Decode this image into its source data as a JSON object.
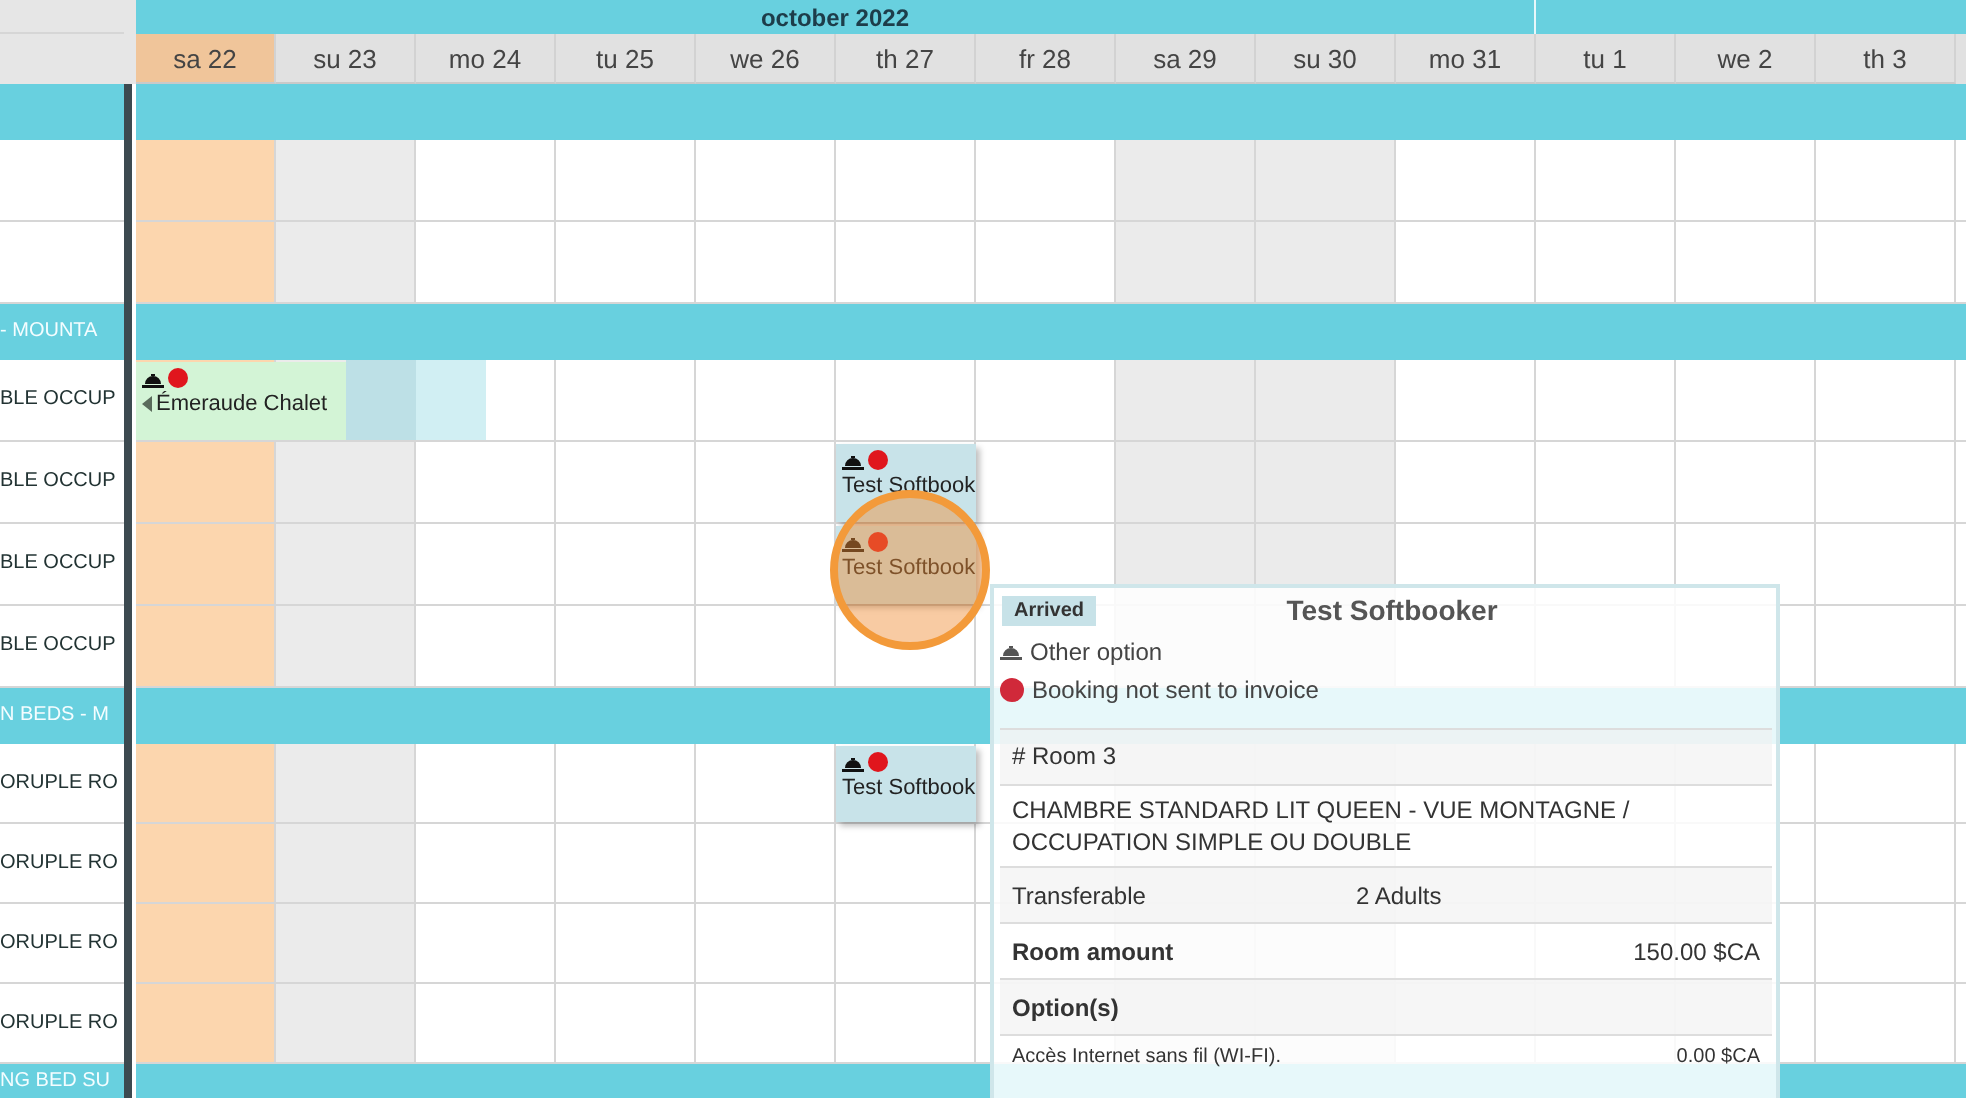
{
  "calendar": {
    "month": "october 2022",
    "days": [
      {
        "label": "sa 22",
        "kind": "today"
      },
      {
        "label": "su 23",
        "kind": "weekend"
      },
      {
        "label": "mo 24",
        "kind": "weekday"
      },
      {
        "label": "tu 25",
        "kind": "weekday"
      },
      {
        "label": "we 26",
        "kind": "weekday"
      },
      {
        "label": "th 27",
        "kind": "weekday"
      },
      {
        "label": "fr 28",
        "kind": "weekday"
      },
      {
        "label": "sa 29",
        "kind": "weekend"
      },
      {
        "label": "su 30",
        "kind": "weekend"
      },
      {
        "label": "mo 31",
        "kind": "weekday"
      },
      {
        "label": "tu 1",
        "kind": "weekday"
      },
      {
        "label": "we 2",
        "kind": "weekday"
      },
      {
        "label": "th 3",
        "kind": "weekday"
      }
    ],
    "rows": [
      {
        "kind": "group"
      },
      {
        "kind": "room"
      },
      {
        "kind": "room"
      },
      {
        "kind": "group",
        "label": "- MOUNTA"
      },
      {
        "kind": "room",
        "label": "BLE OCCUP",
        "bookings": [
          {
            "label": "Émeraude Chalet",
            "color": "#d3f4d6",
            "continues_left": true,
            "checkout": true,
            "highlighted": false
          }
        ]
      },
      {
        "kind": "room",
        "label": "BLE OCCUP",
        "bookings": [
          {
            "label": "Test Softbook",
            "color": "#c8e3e9",
            "continues_left": false,
            "checkout": false,
            "highlighted": false
          }
        ]
      },
      {
        "kind": "room",
        "label": "BLE OCCUP",
        "bookings": [
          {
            "label": "Test Softbook",
            "color": "#c8e3e9",
            "continues_left": false,
            "checkout": false,
            "highlighted": true
          }
        ]
      },
      {
        "kind": "room",
        "label": "BLE OCCUP"
      },
      {
        "kind": "group",
        "label": "N BEDS - M"
      },
      {
        "kind": "room",
        "label": "ORUPLE RO",
        "bookings": [
          {
            "label": "Test Softbook",
            "color": "#c8e3e9",
            "continues_left": false,
            "checkout": false,
            "highlighted": false
          }
        ]
      },
      {
        "kind": "room",
        "label": "ORUPLE RO"
      },
      {
        "kind": "room",
        "label": "ORUPLE RO"
      },
      {
        "kind": "room",
        "label": "ORUPLE RO"
      },
      {
        "kind": "group",
        "label": "NG BED SU"
      }
    ]
  },
  "popup": {
    "badge": "Arrived",
    "title": "Test Softbooker",
    "notes": [
      {
        "kind": "option",
        "text": "Other option"
      },
      {
        "kind": "invoice",
        "text": "Booking not sent to invoice"
      }
    ],
    "details": [
      {
        "kind": "plain",
        "label": "# Room 3"
      },
      {
        "kind": "plain",
        "label": "CHAMBRE STANDARD LIT QUEEN - VUE MONTAGNE / OCCUPATION SIMPLE OU DOUBLE"
      },
      {
        "kind": "pair",
        "label": "Transferable",
        "value": "2 Adults"
      },
      {
        "kind": "amount",
        "label": "Room amount",
        "value": "150.00 $CA"
      },
      {
        "kind": "heading",
        "label": "Option(s)"
      },
      {
        "kind": "option",
        "label": "Accès Internet sans fil (WI-FI).",
        "value": "0.00 $CA"
      }
    ]
  }
}
